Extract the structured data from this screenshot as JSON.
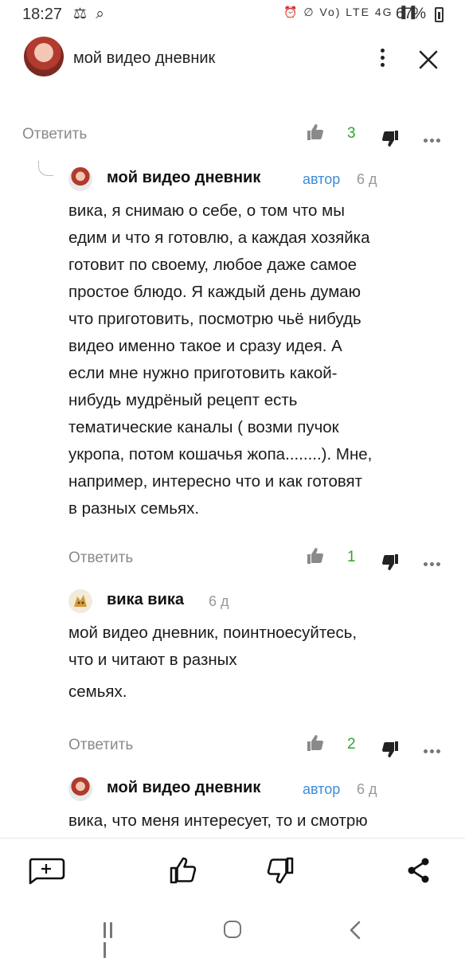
{
  "status_bar": {
    "time": "18:27",
    "left_icons": "⚖ ⌕",
    "right_icons": "⏰ ∅ Vo) LTE 4G ▐▐",
    "battery": "67%"
  },
  "header": {
    "title": "мой видео дневник",
    "avatar": "avatar-woman"
  },
  "actions": [
    {
      "reply": "Ответить",
      "likes": "3"
    },
    {
      "reply": "Ответить",
      "likes": "1"
    },
    {
      "reply": "Ответить",
      "likes": "2"
    }
  ],
  "comments": [
    {
      "author": "мой видео дневник",
      "badge": "автор",
      "time": "6 д",
      "lines": [
        "вика, я снимаю о себе, о том что мы",
        "едим и что я готовлю, а каждая хозяйка",
        "готовит по своему, любое даже самое",
        "простое блюдо. Я каждый день думаю",
        "что приготовить, посмотрю чьё нибудь",
        "видео именно такое и сразу идея. А",
        "если мне нужно приготовить какой-",
        "нибудь мудрёный рецепт есть",
        "тематические каналы ( возми пучок",
        "укропа, потом кошачья жопа........). Мне,",
        "например, интересно что и как готовят",
        "в разных семьях."
      ]
    },
    {
      "author": "вика вика",
      "time": "6 д",
      "lines": [
        "мой видео дневник, поинтноесуйтесь,",
        "что и читают в разных",
        "семьях."
      ]
    },
    {
      "author": "мой видео дневник",
      "badge": "автор",
      "time": "6 д",
      "lines": [
        "вика, что меня интересует, то и смотрю"
      ]
    }
  ],
  "toolbar": {
    "icons": [
      "comment-add-icon",
      "like-icon",
      "dislike-icon",
      "share-icon"
    ]
  },
  "nav": {
    "icons": [
      "recent-apps-icon",
      "home-icon",
      "back-icon"
    ]
  },
  "colors": {
    "like_count": "#31a330",
    "author_badge": "#3d8bd9",
    "muted": "#8a8a8a"
  }
}
